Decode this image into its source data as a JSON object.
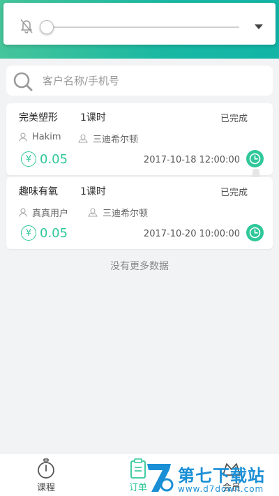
{
  "search": {
    "placeholder": "客户名称/手机号",
    "value": ""
  },
  "volume": {
    "level": 0
  },
  "orders": [
    {
      "title": "完美塑形",
      "hours": "1课时",
      "status": "已完成",
      "customer": "Hakim",
      "location": "三迪希尔顿",
      "currency": "¥",
      "price": "0.05",
      "datetime": "2017-10-18 12:00:00"
    },
    {
      "title": "趣味有氧",
      "hours": "1课时",
      "status": "已完成",
      "customer": "真真用户",
      "location": "三迪希尔顿",
      "currency": "¥",
      "price": "0.05",
      "datetime": "2017-10-20 10:00:00"
    }
  ],
  "list_footer": "没有更多数据",
  "nav": {
    "items": [
      {
        "label": "课程",
        "icon": "compass-icon"
      },
      {
        "label": "订单",
        "icon": "clipboard-icon",
        "active": true
      },
      {
        "label": "会员",
        "icon": "member-icon"
      }
    ]
  },
  "watermark": {
    "brand": "第七下载站",
    "url": "www.d7down.com"
  },
  "colors": {
    "accent": "#2fc79a",
    "header_from": "#45c59a",
    "header_to": "#12b5a6",
    "watermark": "#1a8fd6"
  }
}
